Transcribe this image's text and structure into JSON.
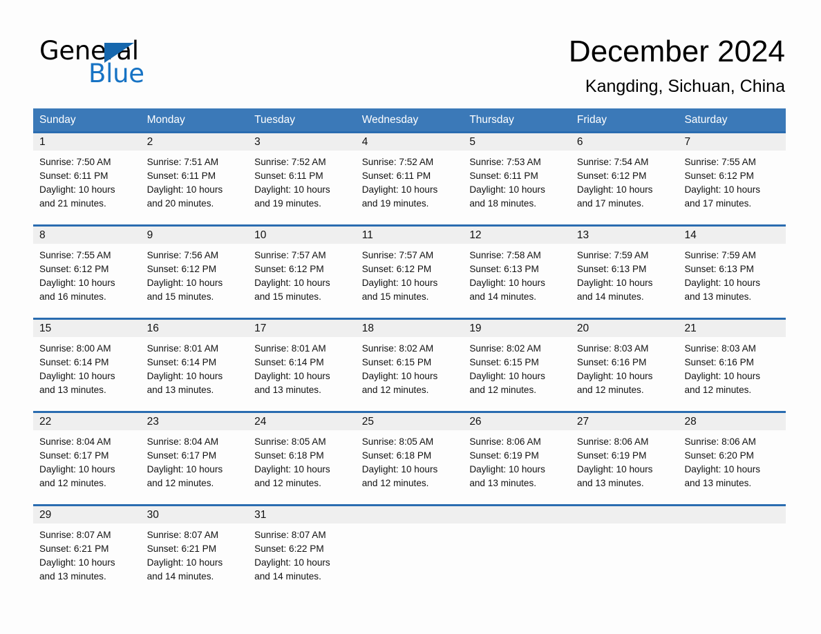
{
  "brand": {
    "name_part1": "General",
    "name_part2": "Blue",
    "accent_color": "#1773c4",
    "triangle_color": "#1667ad"
  },
  "header": {
    "title": "December 2024",
    "subtitle": "Kangding, Sichuan, China"
  },
  "theme": {
    "header_blue": "#3b79b8",
    "row_rule_blue": "#2a6cb0",
    "day_band_gray": "#efefef",
    "page_background": "#fdfdfd"
  },
  "weekdays": [
    "Sunday",
    "Monday",
    "Tuesday",
    "Wednesday",
    "Thursday",
    "Friday",
    "Saturday"
  ],
  "weeks": [
    [
      {
        "day": "1",
        "sunrise": "Sunrise: 7:50 AM",
        "sunset": "Sunset: 6:11 PM",
        "daylight_line1": "Daylight: 10 hours",
        "daylight_line2": "and 21 minutes."
      },
      {
        "day": "2",
        "sunrise": "Sunrise: 7:51 AM",
        "sunset": "Sunset: 6:11 PM",
        "daylight_line1": "Daylight: 10 hours",
        "daylight_line2": "and 20 minutes."
      },
      {
        "day": "3",
        "sunrise": "Sunrise: 7:52 AM",
        "sunset": "Sunset: 6:11 PM",
        "daylight_line1": "Daylight: 10 hours",
        "daylight_line2": "and 19 minutes."
      },
      {
        "day": "4",
        "sunrise": "Sunrise: 7:52 AM",
        "sunset": "Sunset: 6:11 PM",
        "daylight_line1": "Daylight: 10 hours",
        "daylight_line2": "and 19 minutes."
      },
      {
        "day": "5",
        "sunrise": "Sunrise: 7:53 AM",
        "sunset": "Sunset: 6:11 PM",
        "daylight_line1": "Daylight: 10 hours",
        "daylight_line2": "and 18 minutes."
      },
      {
        "day": "6",
        "sunrise": "Sunrise: 7:54 AM",
        "sunset": "Sunset: 6:12 PM",
        "daylight_line1": "Daylight: 10 hours",
        "daylight_line2": "and 17 minutes."
      },
      {
        "day": "7",
        "sunrise": "Sunrise: 7:55 AM",
        "sunset": "Sunset: 6:12 PM",
        "daylight_line1": "Daylight: 10 hours",
        "daylight_line2": "and 17 minutes."
      }
    ],
    [
      {
        "day": "8",
        "sunrise": "Sunrise: 7:55 AM",
        "sunset": "Sunset: 6:12 PM",
        "daylight_line1": "Daylight: 10 hours",
        "daylight_line2": "and 16 minutes."
      },
      {
        "day": "9",
        "sunrise": "Sunrise: 7:56 AM",
        "sunset": "Sunset: 6:12 PM",
        "daylight_line1": "Daylight: 10 hours",
        "daylight_line2": "and 15 minutes."
      },
      {
        "day": "10",
        "sunrise": "Sunrise: 7:57 AM",
        "sunset": "Sunset: 6:12 PM",
        "daylight_line1": "Daylight: 10 hours",
        "daylight_line2": "and 15 minutes."
      },
      {
        "day": "11",
        "sunrise": "Sunrise: 7:57 AM",
        "sunset": "Sunset: 6:12 PM",
        "daylight_line1": "Daylight: 10 hours",
        "daylight_line2": "and 15 minutes."
      },
      {
        "day": "12",
        "sunrise": "Sunrise: 7:58 AM",
        "sunset": "Sunset: 6:13 PM",
        "daylight_line1": "Daylight: 10 hours",
        "daylight_line2": "and 14 minutes."
      },
      {
        "day": "13",
        "sunrise": "Sunrise: 7:59 AM",
        "sunset": "Sunset: 6:13 PM",
        "daylight_line1": "Daylight: 10 hours",
        "daylight_line2": "and 14 minutes."
      },
      {
        "day": "14",
        "sunrise": "Sunrise: 7:59 AM",
        "sunset": "Sunset: 6:13 PM",
        "daylight_line1": "Daylight: 10 hours",
        "daylight_line2": "and 13 minutes."
      }
    ],
    [
      {
        "day": "15",
        "sunrise": "Sunrise: 8:00 AM",
        "sunset": "Sunset: 6:14 PM",
        "daylight_line1": "Daylight: 10 hours",
        "daylight_line2": "and 13 minutes."
      },
      {
        "day": "16",
        "sunrise": "Sunrise: 8:01 AM",
        "sunset": "Sunset: 6:14 PM",
        "daylight_line1": "Daylight: 10 hours",
        "daylight_line2": "and 13 minutes."
      },
      {
        "day": "17",
        "sunrise": "Sunrise: 8:01 AM",
        "sunset": "Sunset: 6:14 PM",
        "daylight_line1": "Daylight: 10 hours",
        "daylight_line2": "and 13 minutes."
      },
      {
        "day": "18",
        "sunrise": "Sunrise: 8:02 AM",
        "sunset": "Sunset: 6:15 PM",
        "daylight_line1": "Daylight: 10 hours",
        "daylight_line2": "and 12 minutes."
      },
      {
        "day": "19",
        "sunrise": "Sunrise: 8:02 AM",
        "sunset": "Sunset: 6:15 PM",
        "daylight_line1": "Daylight: 10 hours",
        "daylight_line2": "and 12 minutes."
      },
      {
        "day": "20",
        "sunrise": "Sunrise: 8:03 AM",
        "sunset": "Sunset: 6:16 PM",
        "daylight_line1": "Daylight: 10 hours",
        "daylight_line2": "and 12 minutes."
      },
      {
        "day": "21",
        "sunrise": "Sunrise: 8:03 AM",
        "sunset": "Sunset: 6:16 PM",
        "daylight_line1": "Daylight: 10 hours",
        "daylight_line2": "and 12 minutes."
      }
    ],
    [
      {
        "day": "22",
        "sunrise": "Sunrise: 8:04 AM",
        "sunset": "Sunset: 6:17 PM",
        "daylight_line1": "Daylight: 10 hours",
        "daylight_line2": "and 12 minutes."
      },
      {
        "day": "23",
        "sunrise": "Sunrise: 8:04 AM",
        "sunset": "Sunset: 6:17 PM",
        "daylight_line1": "Daylight: 10 hours",
        "daylight_line2": "and 12 minutes."
      },
      {
        "day": "24",
        "sunrise": "Sunrise: 8:05 AM",
        "sunset": "Sunset: 6:18 PM",
        "daylight_line1": "Daylight: 10 hours",
        "daylight_line2": "and 12 minutes."
      },
      {
        "day": "25",
        "sunrise": "Sunrise: 8:05 AM",
        "sunset": "Sunset: 6:18 PM",
        "daylight_line1": "Daylight: 10 hours",
        "daylight_line2": "and 12 minutes."
      },
      {
        "day": "26",
        "sunrise": "Sunrise: 8:06 AM",
        "sunset": "Sunset: 6:19 PM",
        "daylight_line1": "Daylight: 10 hours",
        "daylight_line2": "and 13 minutes."
      },
      {
        "day": "27",
        "sunrise": "Sunrise: 8:06 AM",
        "sunset": "Sunset: 6:19 PM",
        "daylight_line1": "Daylight: 10 hours",
        "daylight_line2": "and 13 minutes."
      },
      {
        "day": "28",
        "sunrise": "Sunrise: 8:06 AM",
        "sunset": "Sunset: 6:20 PM",
        "daylight_line1": "Daylight: 10 hours",
        "daylight_line2": "and 13 minutes."
      }
    ],
    [
      {
        "day": "29",
        "sunrise": "Sunrise: 8:07 AM",
        "sunset": "Sunset: 6:21 PM",
        "daylight_line1": "Daylight: 10 hours",
        "daylight_line2": "and 13 minutes."
      },
      {
        "day": "30",
        "sunrise": "Sunrise: 8:07 AM",
        "sunset": "Sunset: 6:21 PM",
        "daylight_line1": "Daylight: 10 hours",
        "daylight_line2": "and 14 minutes."
      },
      {
        "day": "31",
        "sunrise": "Sunrise: 8:07 AM",
        "sunset": "Sunset: 6:22 PM",
        "daylight_line1": "Daylight: 10 hours",
        "daylight_line2": "and 14 minutes."
      },
      {
        "day": "",
        "sunrise": "",
        "sunset": "",
        "daylight_line1": "",
        "daylight_line2": ""
      },
      {
        "day": "",
        "sunrise": "",
        "sunset": "",
        "daylight_line1": "",
        "daylight_line2": ""
      },
      {
        "day": "",
        "sunrise": "",
        "sunset": "",
        "daylight_line1": "",
        "daylight_line2": ""
      },
      {
        "day": "",
        "sunrise": "",
        "sunset": "",
        "daylight_line1": "",
        "daylight_line2": ""
      }
    ]
  ]
}
